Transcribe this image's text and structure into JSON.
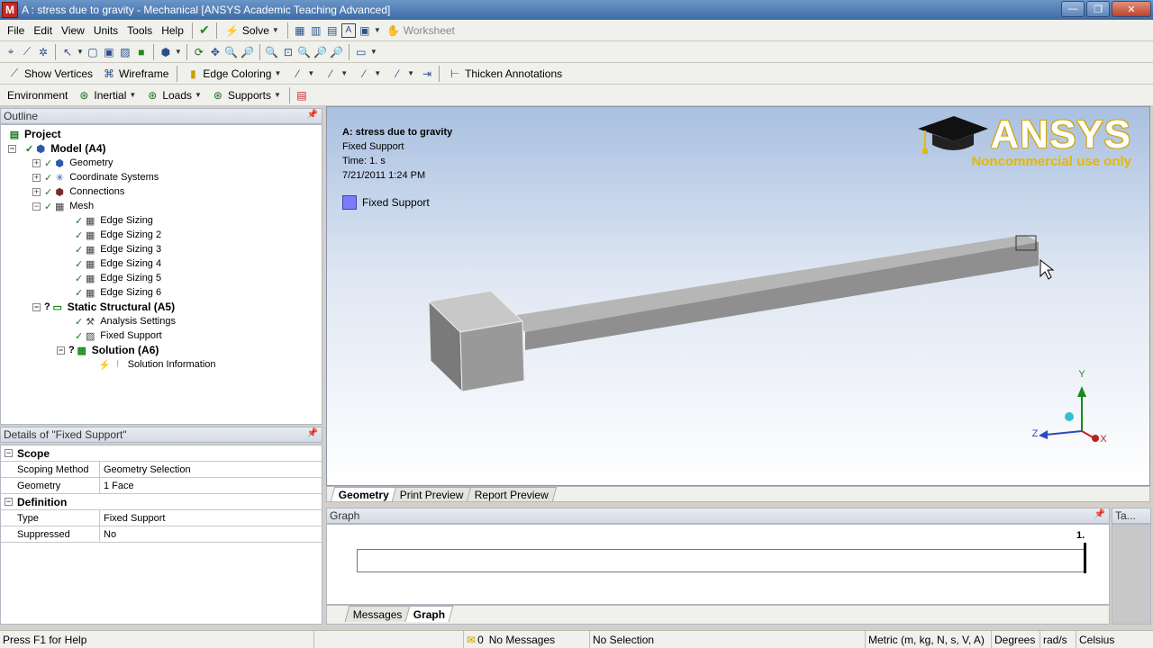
{
  "window": {
    "app_icon_letter": "M",
    "title": "A : stress due to gravity - Mechanical [ANSYS Academic Teaching Advanced]",
    "min": "—",
    "max": "❐",
    "close": "✕"
  },
  "menu": {
    "items": [
      "File",
      "Edit",
      "View",
      "Units",
      "Tools",
      "Help"
    ],
    "solve": "Solve",
    "worksheet": "Worksheet"
  },
  "toolbar2": {
    "show_vertices": "Show Vertices",
    "wireframe": "Wireframe",
    "edge_coloring": "Edge Coloring",
    "thicken_annotations": "Thicken Annotations"
  },
  "toolbar3": {
    "environment": "Environment",
    "inertial": "Inertial",
    "loads": "Loads",
    "supports": "Supports"
  },
  "outline": {
    "header": "Outline",
    "tree": [
      {
        "label": "Project",
        "bold": true
      },
      {
        "label": "Model (A4)",
        "bold": true
      },
      {
        "label": "Geometry"
      },
      {
        "label": "Coordinate Systems"
      },
      {
        "label": "Connections"
      },
      {
        "label": "Mesh"
      },
      {
        "label": "Edge Sizing"
      },
      {
        "label": "Edge Sizing 2"
      },
      {
        "label": "Edge Sizing 3"
      },
      {
        "label": "Edge Sizing 4"
      },
      {
        "label": "Edge Sizing 5"
      },
      {
        "label": "Edge Sizing 6"
      },
      {
        "label": "Static Structural (A5)",
        "bold": true
      },
      {
        "label": "Analysis Settings"
      },
      {
        "label": "Fixed Support"
      },
      {
        "label": "Solution (A6)",
        "bold": true
      },
      {
        "label": "Solution Information"
      }
    ]
  },
  "details": {
    "header": "Details of \"Fixed Support\"",
    "scope_group": "Scope",
    "scoping_method_key": "Scoping Method",
    "scoping_method_val": "Geometry Selection",
    "geometry_key": "Geometry",
    "geometry_val": "1 Face",
    "definition_group": "Definition",
    "type_key": "Type",
    "type_val": "Fixed Support",
    "suppressed_key": "Suppressed",
    "suppressed_val": "No"
  },
  "viewport": {
    "title": "A: stress due to gravity",
    "subtitle": "Fixed Support",
    "time": "Time: 1. s",
    "date": "7/21/2011 1:24 PM",
    "legend_label": "Fixed Support",
    "logo_name": "ANSYS",
    "logo_sub": "Noncommercial use only",
    "axis_y": "Y",
    "axis_z": "Z",
    "axis_x": "X",
    "colors": {
      "fixed_support": "#7b7bff",
      "logo_gold": "#e6b800"
    }
  },
  "view_tabs": [
    "Geometry",
    "Print Preview",
    "Report Preview"
  ],
  "graph": {
    "header": "Graph",
    "marker_label": "1.",
    "tabs": [
      "Messages",
      "Graph"
    ]
  },
  "ta_panel": {
    "header": "Ta..."
  },
  "status": {
    "help": "Press F1 for Help",
    "messages_count": "0",
    "messages": "No Messages",
    "selection": "No Selection",
    "units": "Metric (m, kg, N, s, V, A)",
    "angle": "Degrees",
    "rot": "rad/s",
    "temp": "Celsius"
  }
}
